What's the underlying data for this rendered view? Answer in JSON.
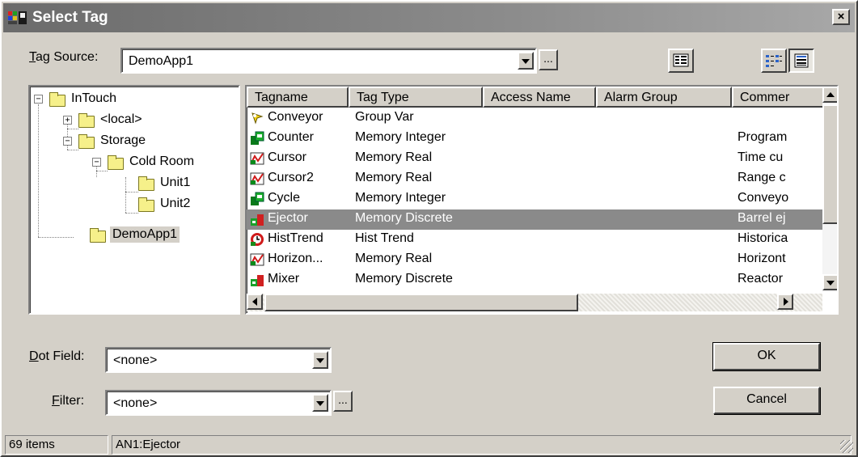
{
  "window": {
    "title": "Select Tag",
    "close_glyph": "×",
    "title_icon": "app-icon"
  },
  "tag_source": {
    "label_key": "T",
    "label_rest": "ag Source:",
    "value": "DemoApp1",
    "browse_label": "..."
  },
  "toolbar": {
    "icons": [
      "properties-icon",
      "details-view-icon",
      "list-view-icon"
    ]
  },
  "tree": {
    "items": [
      {
        "label": "InTouch",
        "toggle": "−"
      },
      {
        "label": "<local>",
        "toggle": "+"
      },
      {
        "label": "Storage",
        "toggle": "−"
      },
      {
        "label": "Cold Room",
        "toggle": "−"
      },
      {
        "label": "Unit1"
      },
      {
        "label": "Unit2"
      },
      {
        "label": "DemoApp1",
        "selected": true
      }
    ]
  },
  "table": {
    "columns": [
      "Tagname",
      "Tag Type",
      "Access Name",
      "Alarm Group",
      "Commer"
    ],
    "rows": [
      {
        "icon": "group-var-icon",
        "name": "Conveyor",
        "type": "Group Var",
        "comment": ""
      },
      {
        "icon": "memory-integer-icon",
        "name": "Counter",
        "type": "Memory Integer",
        "comment": "Program"
      },
      {
        "icon": "memory-real-icon",
        "name": "Cursor",
        "type": "Memory Real",
        "comment": "Time cu"
      },
      {
        "icon": "memory-real-icon",
        "name": "Cursor2",
        "type": "Memory Real",
        "comment": "Range c"
      },
      {
        "icon": "memory-integer-icon",
        "name": "Cycle",
        "type": "Memory Integer",
        "comment": "Conveyo"
      },
      {
        "icon": "memory-discrete-icon",
        "name": "Ejector",
        "type": "Memory Discrete",
        "comment": "Barrel ej",
        "selected": true
      },
      {
        "icon": "hist-trend-icon",
        "name": "HistTrend",
        "type": "Hist Trend",
        "comment": "Historica"
      },
      {
        "icon": "memory-real-icon",
        "name": "Horizon...",
        "type": "Memory Real",
        "comment": "Horizont"
      },
      {
        "icon": "memory-discrete-icon",
        "name": "Mixer",
        "type": "Memory Discrete",
        "comment": "Reactor"
      }
    ]
  },
  "dot_field": {
    "label_key": "D",
    "label_rest": "ot Field:",
    "value": "<none>"
  },
  "filter": {
    "label_key": "F",
    "label_rest": "ilter:",
    "value": "<none>",
    "browse_label": "..."
  },
  "buttons": {
    "ok": "OK",
    "cancel": "Cancel"
  },
  "status": {
    "count": "69 items",
    "selection": "AN1:Ejector"
  }
}
